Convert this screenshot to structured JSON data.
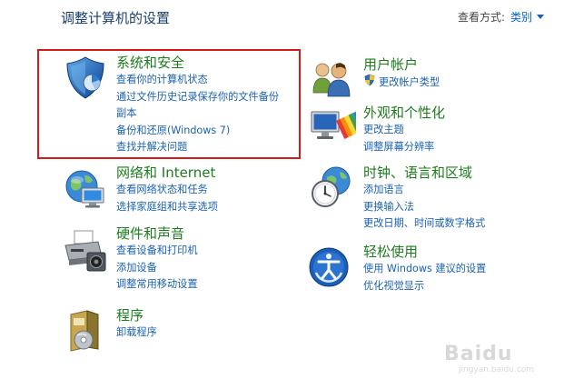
{
  "header": {
    "title": "调整计算机的设置",
    "view_by_label": "查看方式:",
    "view_by_value": "类别"
  },
  "categories": [
    {
      "title": "系统和安全",
      "links": [
        "查看你的计算机状态",
        "通过文件历史记录保存你的文件备份",
        "副本",
        "备份和还原(Windows 7)",
        "查找并解决问题"
      ]
    },
    {
      "title": "网络和 Internet",
      "links": [
        "查看网络状态和任务",
        "选择家庭组和共享选项"
      ]
    },
    {
      "title": "硬件和声音",
      "links": [
        "查看设备和打印机",
        "添加设备",
        "调整常用移动设置"
      ]
    },
    {
      "title": "程序",
      "links": [
        "卸载程序"
      ]
    },
    {
      "title": "用户帐户",
      "links": [
        "更改帐户类型"
      ]
    },
    {
      "title": "外观和个性化",
      "links": [
        "更改主题",
        "调整屏幕分辨率"
      ]
    },
    {
      "title": "时钟、语言和区域",
      "links": [
        "添加语言",
        "更换输入法",
        "更改日期、时间或数字格式"
      ]
    },
    {
      "title": "轻松使用",
      "links": [
        "使用 Windows 建议的设置",
        "优化视觉显示"
      ]
    }
  ],
  "icons": [
    "shield-icon",
    "network-globe-icon",
    "printer-icon",
    "programs-box-icon",
    "users-icon",
    "uac-shield-icon",
    "appearance-monitor-icon",
    "clock-globe-icon",
    "ease-of-access-icon"
  ],
  "colors": {
    "link": "#1b62ad",
    "category_title": "#1d7d1d",
    "highlight_box": "#d61a1a"
  }
}
